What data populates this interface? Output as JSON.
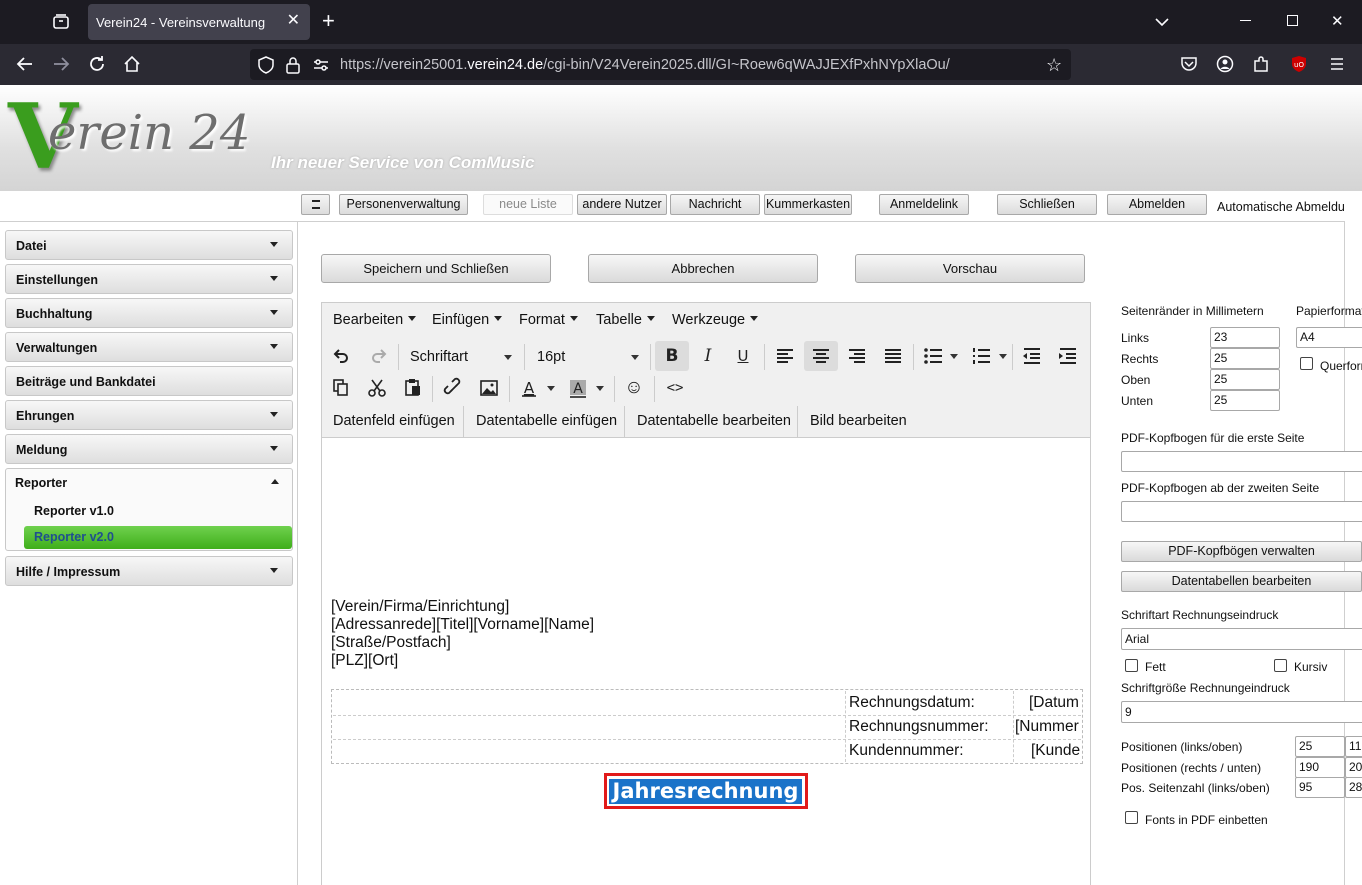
{
  "browser": {
    "tab_title": "Verein24 - Vereinsverwaltung",
    "url_prefix": "https://verein25001.",
    "url_domain": "verein24.de",
    "url_path": "/cgi-bin/V24Verein2025.dll/GI~Roew6qWAJJEXfPxhNYpXlaOu/"
  },
  "header": {
    "logo_v": "V",
    "logo_text": "erein 24",
    "slogan": "Ihr neuer Service von ComMusic"
  },
  "toolbar": {
    "personen": "Personenverwaltung",
    "neue_liste": "neue Liste",
    "andere_nutzer": "andere Nutzer",
    "nachricht": "Nachricht",
    "kummerkasten": "Kummerkasten",
    "anmeldelink": "Anmeldelink",
    "schliessen": "Schließen",
    "abmelden": "Abmelden",
    "auto_logout": "Automatische Abmeldung"
  },
  "sidebar": {
    "items": [
      "Datei",
      "Einstellungen",
      "Buchhaltung",
      "Verwaltungen",
      "Beiträge und Bankdatei",
      "Ehrungen",
      "Meldung",
      "Reporter",
      "Hilfe / Impressum"
    ],
    "reporter_sub": [
      "Reporter v1.0",
      "Reporter v2.0"
    ]
  },
  "actions": {
    "save_close": "Speichern und Schließen",
    "cancel": "Abbrechen",
    "preview": "Vorschau"
  },
  "editor": {
    "menus": [
      "Bearbeiten",
      "Einfügen",
      "Format",
      "Tabelle",
      "Werkzeuge"
    ],
    "font_family": "Schriftart",
    "font_size": "16pt",
    "custom_buttons": [
      "Datenfeld einfügen",
      "Datentabelle einfügen",
      "Datentabelle bearbeiten",
      "Bild bearbeiten"
    ],
    "address_lines": [
      "[Verein/Firma/Einrichtung]",
      "[Adressanrede][Titel][Vorname][Name]",
      "[Straße/Postfach]",
      "[PLZ][Ort]"
    ],
    "table": [
      {
        "label": "Rechnungsdatum:",
        "value": "[Datum"
      },
      {
        "label": "Rechnungsnummer:",
        "value": "[Nummer"
      },
      {
        "label": "Kundennummer:",
        "value": "[Kunde"
      }
    ],
    "title": "Jahresrechnung"
  },
  "settings": {
    "margins_label": "Seitenränder in Millimetern",
    "paper_label": "Papierformat",
    "links_label": "Links",
    "links": "23",
    "rechts_label": "Rechts",
    "rechts": "25",
    "oben_label": "Oben",
    "oben": "25",
    "unten_label": "Unten",
    "unten": "25",
    "paper_value": "A4",
    "landscape_label": "Querformat",
    "pdf_first_label": "PDF-Kopfbogen für die erste Seite",
    "pdf_second_label": "PDF-Kopfbogen ab der zweiten Seite",
    "pdf_manage": "PDF-Kopfbögen verwalten",
    "datatables_edit": "Datentabellen bearbeiten",
    "font_label": "Schriftart Rechnungseindruck",
    "font_value": "Arial",
    "bold_label": "Fett",
    "italic_label": "Kursiv",
    "fontsize_label": "Schriftgröße Rechnungeindruck",
    "fontsize_value": "9",
    "pos_lo_label": "Positionen (links/oben)",
    "pos_lo_1": "25",
    "pos_lo_2": "11",
    "pos_ru_label": "Positionen (rechts / unten)",
    "pos_ru_1": "190",
    "pos_ru_2": "20",
    "pos_page_label": "Pos. Seitenzahl (links/oben)",
    "pos_page_1": "95",
    "pos_page_2": "28",
    "embed_fonts_label": "Fonts in PDF einbetten"
  }
}
